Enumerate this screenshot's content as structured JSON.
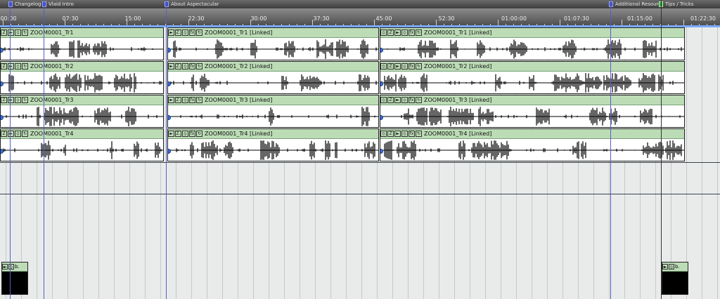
{
  "markers": [
    {
      "label": "Changelog",
      "color": "blue"
    },
    {
      "label": "Vlaid Intro",
      "color": "blue"
    },
    {
      "label": "About Aspectacular",
      "color": "blue"
    },
    {
      "label": "Additional Resourc",
      "color": "blue"
    },
    {
      "label": "Tips / Tricks",
      "color": "green"
    }
  ],
  "ruler": {
    "labels": [
      "00:00",
      "07:30",
      "15:00",
      "22:30",
      "30:00",
      "37:30",
      "45:00",
      "52:30",
      "01:00:00",
      "01:07:30",
      "01:15:00",
      "01:22:30"
    ]
  },
  "tracks": [
    {
      "name": "ZOOM0001_Tr1",
      "linked": "ZOOM0001_Tr1 [Linked]"
    },
    {
      "name": "ZOOM0001_Tr2",
      "linked": "ZOOM0001_Tr2 [Linked]"
    },
    {
      "name": "ZOOM0001_Tr3",
      "linked": "ZOOM0001_Tr3 [Linked]"
    },
    {
      "name": "ZOOM0001_Tr4",
      "linked": "ZOOM0001_Tr4 [Linked]"
    }
  ],
  "event_buttons": {
    "play": "►",
    "zoom": "Z",
    "zoom_dot": "Z.",
    "mute": "⦸",
    "fx": "fx",
    "loop": "↻"
  },
  "mini_event_label": "b.",
  "colors": {
    "header_green": "#bcdcb6",
    "cursor": "#5a5cc8",
    "marker_flag": "#3a4cc8"
  }
}
